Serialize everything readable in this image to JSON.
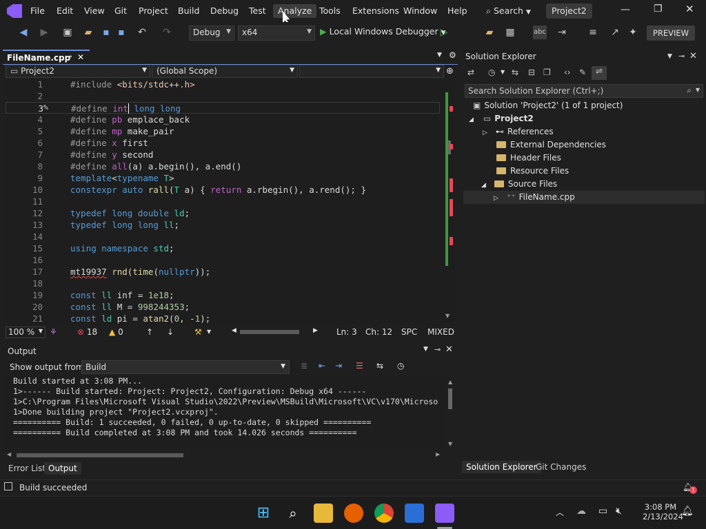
{
  "menu": {
    "items": [
      "File",
      "Edit",
      "View",
      "Git",
      "Project",
      "Build",
      "Debug",
      "Test",
      "Analyze",
      "Tools",
      "Extensions",
      "Window",
      "Help"
    ],
    "search_label": "Search",
    "project_title": "Project2"
  },
  "toolbar": {
    "configuration": "Debug",
    "platform": "x64",
    "run_label": "Local Windows Debugger",
    "preview_label": "PREVIEW"
  },
  "editor": {
    "tab_label": "FileName.cpp",
    "nav_project": "Project2",
    "nav_scope": "(Global Scope)",
    "lines": [
      {
        "n": "1",
        "html": "<span class='pp'>#include</span> <span class='str'>&lt;bits/stdc++.h&gt;</span>"
      },
      {
        "n": "2",
        "html": ""
      },
      {
        "n": "3",
        "html": "<span class='pp'>#define</span> <span class='mac'>int</span><span style='border-left:1px solid #fff'></span> <span class='kw'>long long</span>"
      },
      {
        "n": "4",
        "html": "<span class='pp'>#define</span> <span class='mac'>pb</span> emplace_back"
      },
      {
        "n": "5",
        "html": "<span class='pp'>#define</span> <span class='mac'>mp</span> make_pair"
      },
      {
        "n": "6",
        "html": "<span class='pp'>#define</span> <span class='mac'>x</span> first"
      },
      {
        "n": "7",
        "html": "<span class='pp'>#define</span> <span class='mac'>y</span> second"
      },
      {
        "n": "8",
        "html": "<span class='pp'>#define</span> <span class='mac'>all</span>(a) a.begin(), a.end()"
      },
      {
        "n": "9",
        "html": "<span class='kw'>template</span>&lt;<span class='kw'>typename</span> <span class='ty'>T</span>&gt;"
      },
      {
        "n": "10",
        "html": "<span class='kw'>constexpr auto</span> <span class='fn'>rall</span>(<span class='ty'>T</span> a) { <span class='mac'>return</span> a.rbegin(), a.rend(); }"
      },
      {
        "n": "11",
        "html": ""
      },
      {
        "n": "12",
        "html": "<span class='kw'>typedef long double</span> <span class='ty'>ld</span>;"
      },
      {
        "n": "13",
        "html": "<span class='kw'>typedef long long</span> <span class='ty'>ll</span>;"
      },
      {
        "n": "14",
        "html": ""
      },
      {
        "n": "15",
        "html": "<span class='kw'>using namespace</span> <span class='ty'>std</span>;"
      },
      {
        "n": "16",
        "html": ""
      },
      {
        "n": "17",
        "html": "<span class='squig'>mt19937</span> <span class='fn'>rnd</span>(<span class='fn'>time</span>(<span class='kw'>nullptr</span>));"
      },
      {
        "n": "18",
        "html": ""
      },
      {
        "n": "19",
        "html": "<span class='kw'>const</span> <span class='ty'>ll</span> inf = <span class='num'>1e18</span>;"
      },
      {
        "n": "20",
        "html": "<span class='kw'>const</span> <span class='ty'>ll</span> M = <span class='num'>998244353</span>;"
      },
      {
        "n": "21",
        "html": "<span class='kw'>const</span> <span class='ty'>ld</span> pi = <span class='fn'>atan2</span>(<span class='num'>0</span>, -<span class='num'>1</span>);"
      }
    ]
  },
  "editor_status": {
    "zoom": "100 %",
    "errors": "18",
    "warnings": "0",
    "line": "Ln: 3",
    "col": "Ch: 12",
    "spacing": "SPC",
    "line_endings": "MIXED"
  },
  "output": {
    "title": "Output",
    "show_from_label": "Show output from:",
    "source": "Build",
    "text": "Build started at 3:08 PM...\n1>------ Build started: Project: Project2, Configuration: Debug x64 ------\n1>C:\\Program Files\\Microsoft Visual Studio\\2022\\Preview\\MSBuild\\Microsoft\\VC\\v170\\Microso\n1>Done building project \"Project2.vcxproj\".\n========== Build: 1 succeeded, 0 failed, 0 up-to-date, 0 skipped ==========\n========== Build completed at 3:08 PM and took 14.026 seconds =========="
  },
  "bottom_tabs": [
    "Error List",
    "Output"
  ],
  "solution": {
    "title": "Solution Explorer",
    "search_placeholder": "Search Solution Explorer (Ctrl+;)",
    "root": "Solution 'Project2' (1 of 1 project)",
    "project": "Project2",
    "items": [
      "References",
      "External Dependencies",
      "Header Files",
      "Resource Files",
      "Source Files",
      "FileName.cpp"
    ],
    "tabs": [
      "Solution Explorer",
      "Git Changes"
    ]
  },
  "status": {
    "message": "Build succeeded",
    "notifications": "1"
  },
  "taskbar": {
    "time": "3:08 PM",
    "date": "2/13/2024"
  },
  "colors": {
    "accent": "#6b8bd6",
    "error": "#e74856",
    "success_bar": "#3c9a3c"
  }
}
